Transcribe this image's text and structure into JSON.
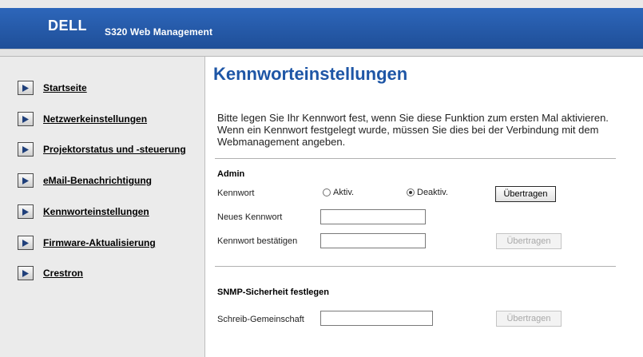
{
  "header": {
    "product_title": "S320 Web Management",
    "brand": "DELL"
  },
  "sidebar": {
    "items": [
      {
        "label": "Startseite"
      },
      {
        "label": "Netzwerkeinstellungen"
      },
      {
        "label": "Projektorstatus und -steuerung"
      },
      {
        "label": "eMail-Benachrichtigung"
      },
      {
        "label": "Kennworteinstellungen"
      },
      {
        "label": "Firmware-Aktualisierung"
      },
      {
        "label": "Crestron"
      }
    ]
  },
  "main": {
    "title": "Kennworteinstellungen",
    "intro": "Bitte legen Sie Ihr Kennwort fest, wenn Sie diese Funktion zum ersten Mal aktivieren. Wenn ein Kennwort festgelegt wurde, müssen Sie dies bei der Verbindung mit dem Webmanagement angeben.",
    "admin": {
      "heading": "Admin",
      "password_label": "Kennwort",
      "radio_active": "Aktiv.",
      "radio_inactive": "Deaktiv.",
      "selected": "Deaktiv.",
      "submit_label": "Übertragen",
      "new_password_label": "Neues Kennwort",
      "new_password_value": "",
      "confirm_label": "Kennwort bestätigen",
      "confirm_value": "",
      "confirm_submit_label": "Übertragen"
    },
    "snmp": {
      "heading": "SNMP-Sicherheit festlegen",
      "community_label": "Schreib-Gemeinschaft",
      "community_value": "",
      "submit_label": "Übertragen"
    }
  },
  "colors": {
    "header_blue": "#2a5fb0",
    "title_blue": "#1e56a6",
    "sidebar_bg": "#ebebeb"
  }
}
